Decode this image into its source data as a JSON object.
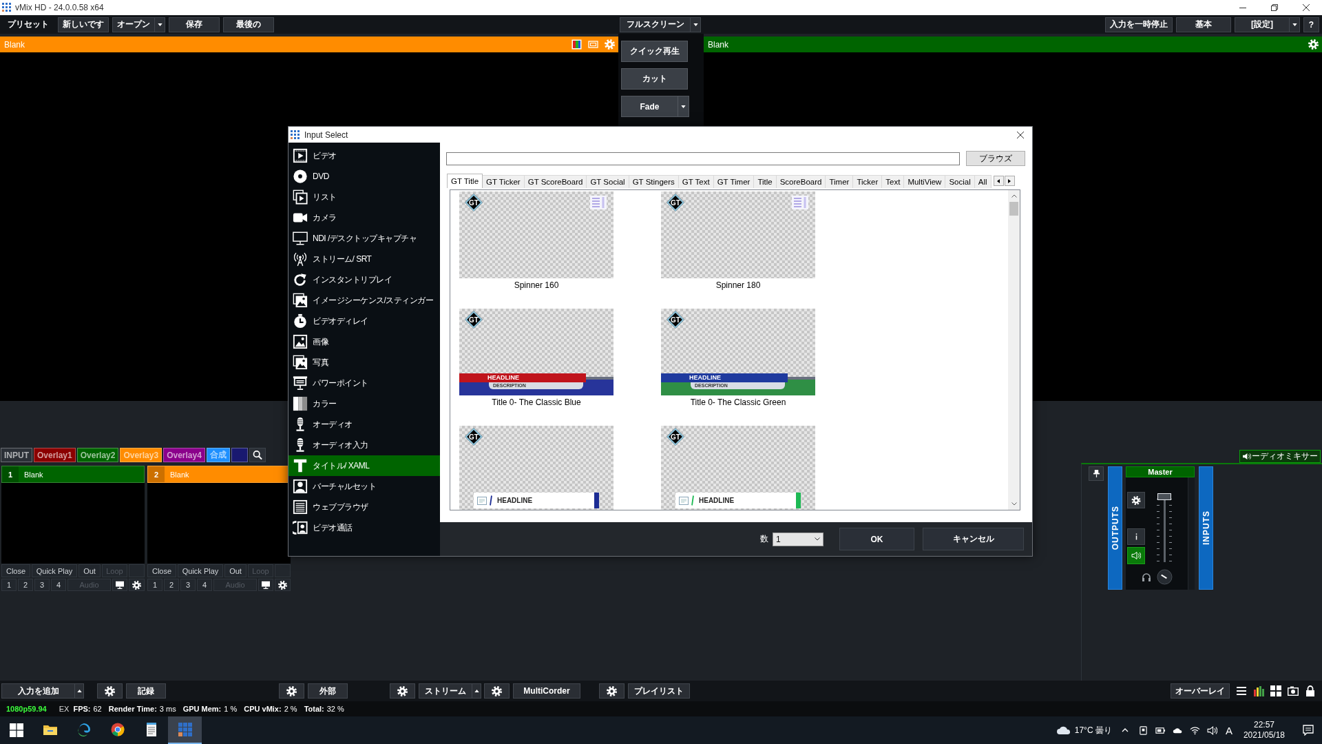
{
  "window": {
    "title": "vMix HD - 24.0.0.58 x64"
  },
  "menu_bar": {
    "left": [
      {
        "label": "プリセット",
        "kind": "plain"
      },
      {
        "label": "新しいです",
        "kind": "button"
      },
      {
        "label": "オープン",
        "kind": "split"
      },
      {
        "label": "保存",
        "kind": "button"
      },
      {
        "label": "最後の",
        "kind": "button"
      }
    ],
    "center": [
      {
        "label": "フルスクリーン",
        "kind": "split"
      }
    ],
    "right": [
      {
        "label": "入力を一時停止",
        "kind": "button"
      },
      {
        "label": "基本",
        "kind": "button"
      },
      {
        "label": "[設定]",
        "kind": "split"
      },
      {
        "label": "?",
        "kind": "small"
      }
    ]
  },
  "preview": {
    "title": "Blank"
  },
  "transitions": [
    {
      "label": "クイック再生",
      "kind": "button"
    },
    {
      "label": "カット",
      "kind": "button"
    },
    {
      "label": "Fade",
      "kind": "split"
    }
  ],
  "output": {
    "title": "Blank"
  },
  "input_tabs": [
    {
      "label": "INPUT",
      "color": "#2b3037"
    },
    {
      "label": "Overlay1",
      "color": "#8b0000"
    },
    {
      "label": "Overlay2",
      "color": "#006400"
    },
    {
      "label": "Overlay3",
      "color": "#ff8c00"
    },
    {
      "label": "Overlay4",
      "color": "#8b008b"
    },
    {
      "label": "合成",
      "color": "#1e90ff"
    },
    {
      "color": "#191970"
    }
  ],
  "inputs": [
    {
      "number": "1",
      "title": "Blank",
      "color": "#006400",
      "controls": [
        {
          "label": "Close",
          "disabled": false
        },
        {
          "label": "Quick Play",
          "disabled": false
        },
        {
          "label": "Out",
          "disabled": false
        },
        {
          "label": "Loop",
          "disabled": true
        }
      ],
      "buses": [
        "1",
        "2",
        "3",
        "4"
      ],
      "audio": {
        "label": "Audio",
        "disabled": true
      }
    },
    {
      "number": "2",
      "title": "Blank",
      "color": "#ff8c00",
      "controls": [
        {
          "label": "Close",
          "disabled": false
        },
        {
          "label": "Quick Play",
          "disabled": false
        },
        {
          "label": "Out",
          "disabled": false
        },
        {
          "label": "Loop",
          "disabled": true
        }
      ],
      "buses": [
        "1",
        "2",
        "3",
        "4"
      ],
      "audio": {
        "label": "Audio",
        "disabled": true
      }
    }
  ],
  "dialog": {
    "title": "Input Select",
    "categories": [
      {
        "label": "ビデオ",
        "selected": false
      },
      {
        "label": "DVD",
        "selected": false
      },
      {
        "label": "リスト",
        "selected": false
      },
      {
        "label": "カメラ",
        "selected": false
      },
      {
        "label": "NDI /デスクトップキャプチャ",
        "selected": false
      },
      {
        "label": "ストリーム/ SRT",
        "selected": false
      },
      {
        "label": "インスタントリプレイ",
        "selected": false
      },
      {
        "label": "イメージシーケンス/スティンガー",
        "selected": false
      },
      {
        "label": "ビデオディレイ",
        "selected": false
      },
      {
        "label": "画像",
        "selected": false
      },
      {
        "label": "写真",
        "selected": false
      },
      {
        "label": "パワーポイント",
        "selected": false
      },
      {
        "label": "カラー",
        "selected": false
      },
      {
        "label": "オーディオ",
        "selected": false
      },
      {
        "label": "オーディオ入力",
        "selected": false
      },
      {
        "label": "タイトル/ XAML",
        "selected": true
      },
      {
        "label": "バーチャルセット",
        "selected": false
      },
      {
        "label": "ウェブブラウザ",
        "selected": false
      },
      {
        "label": "ビデオ通話",
        "selected": false
      }
    ],
    "browse": "ブラウズ",
    "tabs": [
      {
        "label": "GT Title",
        "selected": true
      },
      {
        "label": "GT Ticker",
        "selected": false
      },
      {
        "label": "GT ScoreBoard",
        "selected": false
      },
      {
        "label": "GT Social",
        "selected": false
      },
      {
        "label": "GT Stingers",
        "selected": false
      },
      {
        "label": "GT Text",
        "selected": false
      },
      {
        "label": "GT Timer",
        "selected": false
      },
      {
        "label": "Title",
        "selected": false
      },
      {
        "label": "ScoreBoard",
        "selected": false
      },
      {
        "label": "Timer",
        "selected": false
      },
      {
        "label": "Ticker",
        "selected": false
      },
      {
        "label": "Text",
        "selected": false
      },
      {
        "label": "MultiView",
        "selected": false
      },
      {
        "label": "Social",
        "selected": false
      },
      {
        "label": "All",
        "selected": false
      }
    ],
    "templates": [
      {
        "name": "Spinner 160",
        "badge": "GT",
        "kind": "spinner"
      },
      {
        "name": "Spinner 180",
        "badge": "GT",
        "kind": "spinner"
      },
      {
        "name": "Title 0- The Classic Blue",
        "badge": "GT",
        "kind": "classic",
        "color": "#27349a",
        "banner": {
          "headline": "HEADLINE",
          "description": "DESCRIPTION",
          "color": "#c0141c"
        }
      },
      {
        "name": "Title 0- The Classic Green",
        "badge": "GT",
        "kind": "classic",
        "color": "#2f8f45",
        "banner": {
          "headline": "HEADLINE",
          "description": "DESCRIPTION",
          "color": "#1f3a9e"
        }
      },
      {
        "badge": "GT",
        "kind": "image-lower-third",
        "color": "#1c2c94",
        "banner": {
          "headline": "HEADLINE"
        }
      },
      {
        "badge": "GT",
        "kind": "image-lower-third",
        "color": "#1db954",
        "banner": {
          "headline": "HEADLINE"
        }
      }
    ],
    "count": {
      "label": "数",
      "value": "1"
    },
    "buttons": [
      "OK",
      "キャンセル"
    ]
  },
  "audio_mixer": {
    "title": "ーディオミキサー",
    "outputs": "OUTPUTS",
    "inputs": "INPUTS",
    "master": {
      "name": "Master",
      "level": 1,
      "audio_on": true
    }
  },
  "toolbar": {
    "groups": [
      {
        "label": "入力を追加",
        "settings": false,
        "dropdown": true
      },
      {
        "label": "記録",
        "settings": true,
        "dropdown": false
      },
      {
        "label": "外部",
        "settings": true,
        "dropdown": false
      },
      {
        "label": "ストリーム",
        "settings": true,
        "dropdown": true
      },
      {
        "label": "MultiCorder",
        "settings": true,
        "dropdown": false
      },
      {
        "label": "プレイリスト",
        "settings": true,
        "dropdown": false
      }
    ],
    "right_button": "オーバーレイ"
  },
  "status_bar": {
    "format": "1080p59.94",
    "mode": "EX",
    "stats": [
      {
        "label": "FPS:",
        "value": "62"
      },
      {
        "label": "Render Time:",
        "value": "3 ms"
      },
      {
        "label": "GPU Mem:",
        "value": "1 %"
      },
      {
        "label": "CPU vMix:",
        "value": "2 %"
      },
      {
        "label": "Total:",
        "value": "32 %"
      }
    ]
  },
  "taskbar": {
    "apps": [
      {
        "selected": false
      },
      {
        "selected": false
      },
      {
        "selected": false
      },
      {
        "selected": false
      },
      {
        "selected": true
      }
    ],
    "weather": "17°C 曇り",
    "ime": "A",
    "time": "22:57",
    "date": "2021/05/18"
  }
}
